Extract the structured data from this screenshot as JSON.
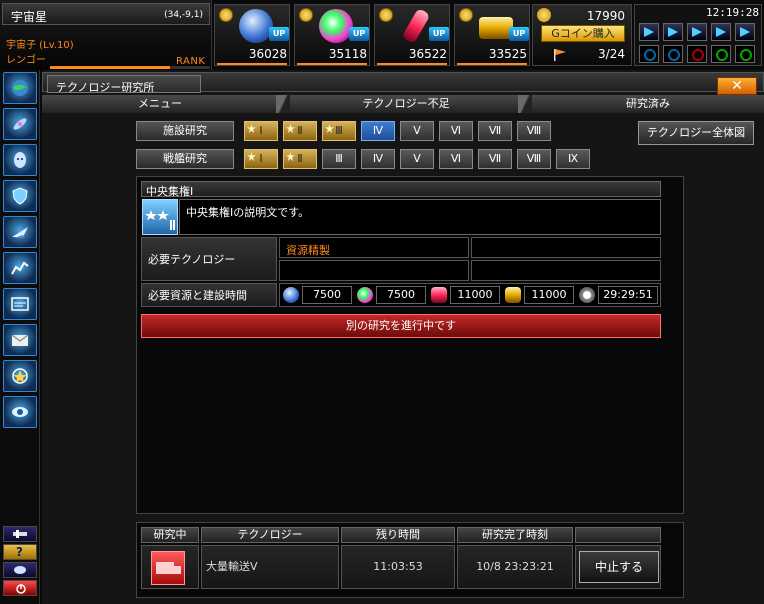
{
  "planet": {
    "name": "宇宙星",
    "coords": "(34,-9,1)",
    "player": "宇宙子 (Lv.10)",
    "rank_name": "レンゴー",
    "rank_label": "RANK",
    "rank_progress": 0.75
  },
  "resources": [
    {
      "id": "crystal",
      "value": "36028",
      "up_label": "UP",
      "color": "#6aa8ff"
    },
    {
      "id": "energy",
      "value": "35118",
      "up_label": "UP",
      "color": "#3aff6a"
    },
    {
      "id": "capsule",
      "value": "36522",
      "up_label": "UP",
      "color": "#ff3a6a"
    },
    {
      "id": "gold",
      "value": "33525",
      "up_label": "UP",
      "color": "#ffc21a"
    }
  ],
  "gcoin": {
    "value": "17990",
    "buy_label": "Gコイン購入",
    "fleet_count": "3/24"
  },
  "clock": "12:19:28",
  "window": {
    "title": "テクノロジー研究所",
    "close_label": "✕"
  },
  "tabs": [
    {
      "label": "メニュー"
    },
    {
      "label": "テクノロジー不足"
    },
    {
      "label": "研究済み"
    }
  ],
  "facility_row": {
    "label": "施設研究",
    "levels": [
      {
        "label": "Ⅰ",
        "state": "done"
      },
      {
        "label": "Ⅱ",
        "state": "done"
      },
      {
        "label": "Ⅲ",
        "state": "done"
      },
      {
        "label": "Ⅳ",
        "state": "current"
      },
      {
        "label": "Ⅴ",
        "state": "locked"
      },
      {
        "label": "Ⅵ",
        "state": "locked"
      },
      {
        "label": "Ⅶ",
        "state": "locked"
      },
      {
        "label": "Ⅷ",
        "state": "locked"
      }
    ]
  },
  "tactics_row": {
    "label": "戦艦研究",
    "levels": [
      {
        "label": "Ⅰ",
        "state": "done"
      },
      {
        "label": "Ⅱ",
        "state": "done"
      },
      {
        "label": "Ⅲ",
        "state": "locked"
      },
      {
        "label": "Ⅳ",
        "state": "locked"
      },
      {
        "label": "Ⅴ",
        "state": "locked"
      },
      {
        "label": "Ⅵ",
        "state": "locked"
      },
      {
        "label": "Ⅶ",
        "state": "locked"
      },
      {
        "label": "Ⅷ",
        "state": "locked"
      },
      {
        "label": "Ⅸ",
        "state": "locked"
      }
    ]
  },
  "overview_label": "テクノロジー全体図",
  "detail": {
    "title": "中央集権Ⅰ",
    "description": "中央集権Ⅰの説明文です。",
    "req_tech_label": "必要テクノロジー",
    "req_tech": [
      "資源精製",
      "",
      "",
      ""
    ],
    "req_cost_label": "必要資源と建設時間",
    "costs": [
      "7500",
      "7500",
      "11000",
      "11000"
    ],
    "time": "29:29:51",
    "status": "別の研究を進行中です"
  },
  "queue": {
    "headers": [
      "研究中",
      "テクノロジー",
      "残り時間",
      "研究完了時刻"
    ],
    "tech": "大量輸送Ⅴ",
    "remaining": "11:03:53",
    "completion": "10/8 23:23:21",
    "cancel_label": "中止する"
  }
}
